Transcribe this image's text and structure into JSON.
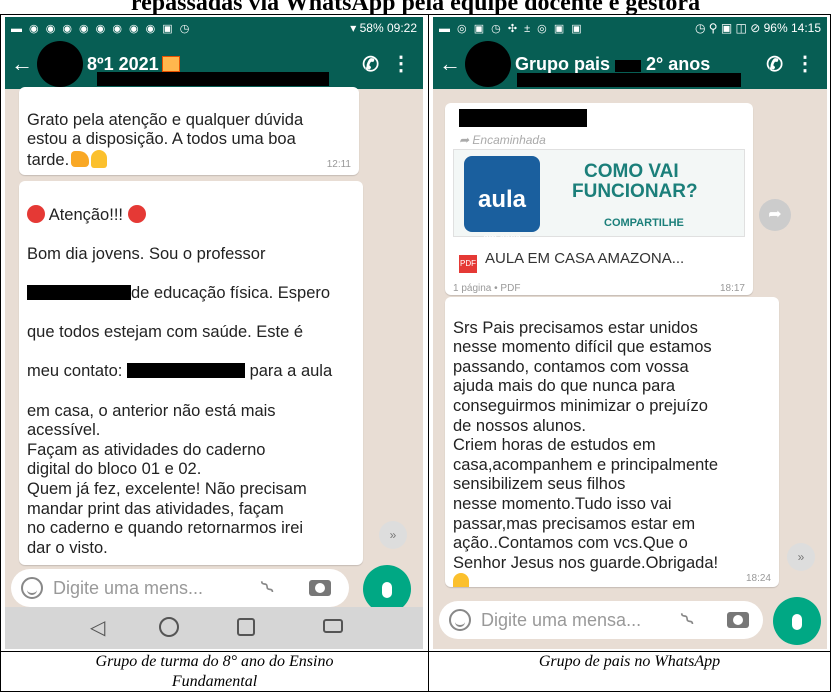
{
  "heading": "repassadas via WhatsApp pela equipe docente e gestora",
  "captions": {
    "left": "Grupo de turma do 8° ano do Ensino Fundamental",
    "right": "Grupo de pais no WhatsApp"
  },
  "left_phone": {
    "status": {
      "icons": "▬ ◉ ◉ ◉ ◉ ◉ ◉ ◉ ◉ ▣ ◷",
      "signal": "▾ 58%",
      "time": "09:22"
    },
    "title": "8º1 2021",
    "bubble_top": {
      "text": "Grato pela atenção e qualquer dúvida\nestou a disposição. A todos uma boa\ntarde.",
      "time": "12:11"
    },
    "bubble_main": {
      "heading": "Atenção!!!",
      "line1": "Bom dia jovens. Sou o professor",
      "line2": "de educação física.  Espero",
      "line3": "que todos estejam com saúde. Este é",
      "line4a": "meu contato:",
      "line4b": "para a aula",
      "body": "em casa, o anterior não está mais\nacessível.\nFaçam as atividades do caderno\ndigital do bloco 01 e 02.\nQuem já fez, excelente! Não precisam\nmandar print das atividades, façam\nno caderno e quando retornarmos irei\ndar o visto.\n\nCaderno digital bloco 01.\nAula 06 – A fase adulta e suas\ncaracterísticas.\nCopiar conteúdo e responder as\nquestões. Pag. 08,09 e 10 (praticando\neducação física)."
    },
    "input_placeholder": "Digite uma mens...",
    "scroll_glyph": "»"
  },
  "right_phone": {
    "status": {
      "icons": "▬ ◎ ▣ ◷ ✣ ± ◎ ▣ ▣",
      "signal": "◷ ⚲ ▣ ◫ ⊘ 96%",
      "time": "14:15"
    },
    "title_a": "Grupo pais",
    "title_b": "2° anos",
    "forwarded": "Encaminhada",
    "card": {
      "logo": "aula",
      "logo_sub": "em casa",
      "logo_badge": "AMAZONAS",
      "line1": "COMO VAI",
      "line2": "FUNCIONAR?",
      "share": "COMPARTILHE"
    },
    "pdf_badge": "PDF",
    "pdf_name": "AULA EM CASA AMAZONA...",
    "pdf_meta": "1 página • PDF",
    "pdf_time": "18:17",
    "message": "Srs Pais precisamos estar unidos\nnesse momento difícil que estamos\npassando, contamos com vossa\najuda mais do que nunca para\nconseguirmos minimizar o prejuízo\nde nossos alunos.\nCriem horas de estudos em\ncasa,acompanhem e principalmente\nsensibilizem seus filhos\nnesse momento.Tudo isso vai\npassar,mas precisamos estar em\nação..Contamos com vcs.Que o\nSenhor Jesus nos guarde.Obrigada!",
    "message_time": "18:24",
    "input_placeholder": "Digite uma mensa...",
    "scroll_glyph": "»"
  }
}
